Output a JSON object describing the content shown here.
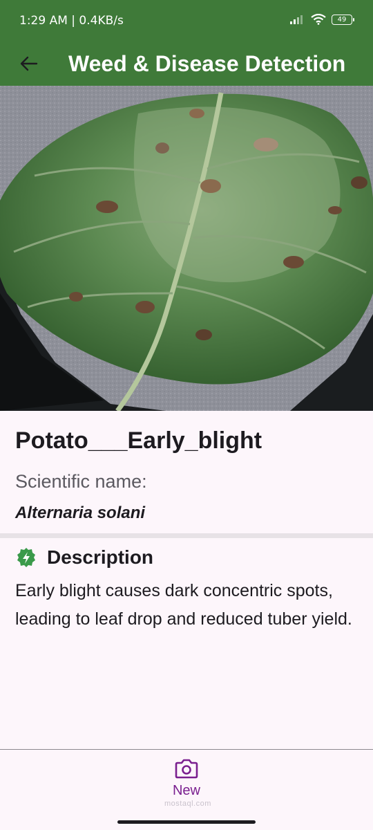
{
  "status_bar": {
    "time": "1:29 AM | 0.4KB/s",
    "battery": "49",
    "icons": [
      "signal-icon",
      "wifi-icon",
      "battery-icon"
    ]
  },
  "app_bar": {
    "title": "Weed & Disease Detection",
    "back_icon": "arrow-left-icon",
    "background": "#3f7a39"
  },
  "result": {
    "disease_name": "Potato___Early_blight",
    "scientific_label": "Scientific name:",
    "scientific_name": "Alternaria solani"
  },
  "description": {
    "icon": "bolt-badge-icon",
    "icon_color": "#3a9a4a",
    "title": "Description",
    "text": "Early blight causes dark concentric spots, leading to leaf drop and reduced tuber yield."
  },
  "bottom_nav": {
    "items": [
      {
        "label": "New",
        "icon": "camera-icon",
        "color": "#7a1f8f"
      }
    ]
  },
  "watermark": "mostaql.com"
}
